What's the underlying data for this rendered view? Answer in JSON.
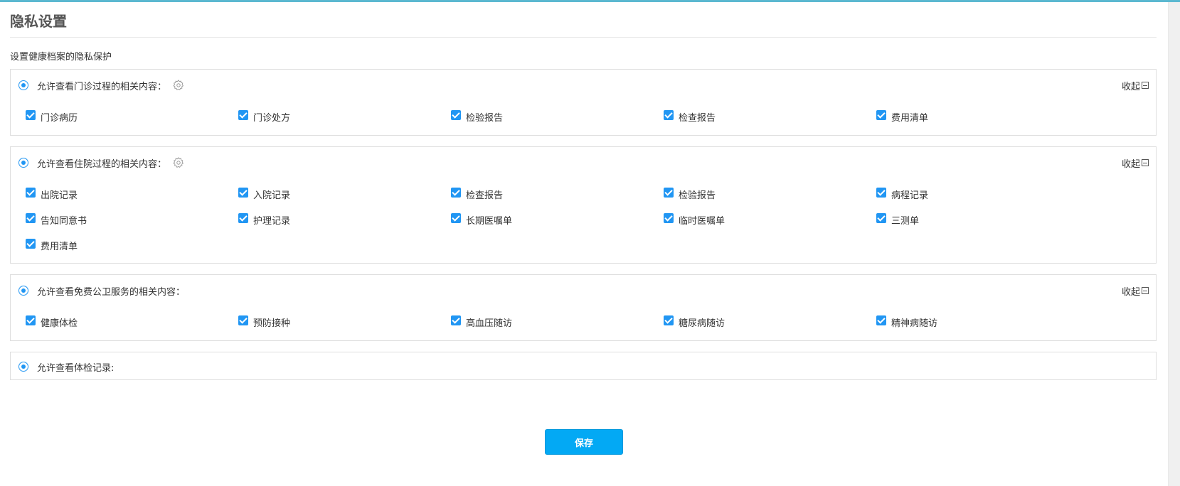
{
  "page": {
    "title": "隐私设置",
    "subtitle": "设置健康档案的隐私保护"
  },
  "sections": [
    {
      "title": "允许查看门诊过程的相关内容：",
      "has_settings": true,
      "collapse_label": "收起",
      "items": [
        "门诊病历",
        "门诊处方",
        "检验报告",
        "检查报告",
        "费用清单"
      ]
    },
    {
      "title": "允许查看住院过程的相关内容：",
      "has_settings": true,
      "collapse_label": "收起",
      "items": [
        "出院记录",
        "入院记录",
        "检查报告",
        "检验报告",
        "病程记录",
        "告知同意书",
        "护理记录",
        "长期医嘱单",
        "临时医嘱单",
        "三测单",
        "费用清单"
      ]
    },
    {
      "title": "允许查看免费公卫服务的相关内容：",
      "has_settings": false,
      "collapse_label": "收起",
      "items": [
        "健康体检",
        "预防接种",
        "高血压随访",
        "糖尿病随访",
        "精神病随访"
      ]
    },
    {
      "title": "允许查看体检记录:",
      "has_settings": false,
      "collapse_label": "",
      "items": []
    }
  ],
  "footer": {
    "save_label": "保存"
  },
  "colors": {
    "accent": "#2196f3",
    "button": "#03a9f4",
    "topbar": "#5bb8d0"
  },
  "icons": {
    "settings": "gear-icon",
    "collapse": "collapse-minus-icon",
    "checkbox": "checkbox-checked-icon",
    "radio": "radio-selected-icon"
  }
}
